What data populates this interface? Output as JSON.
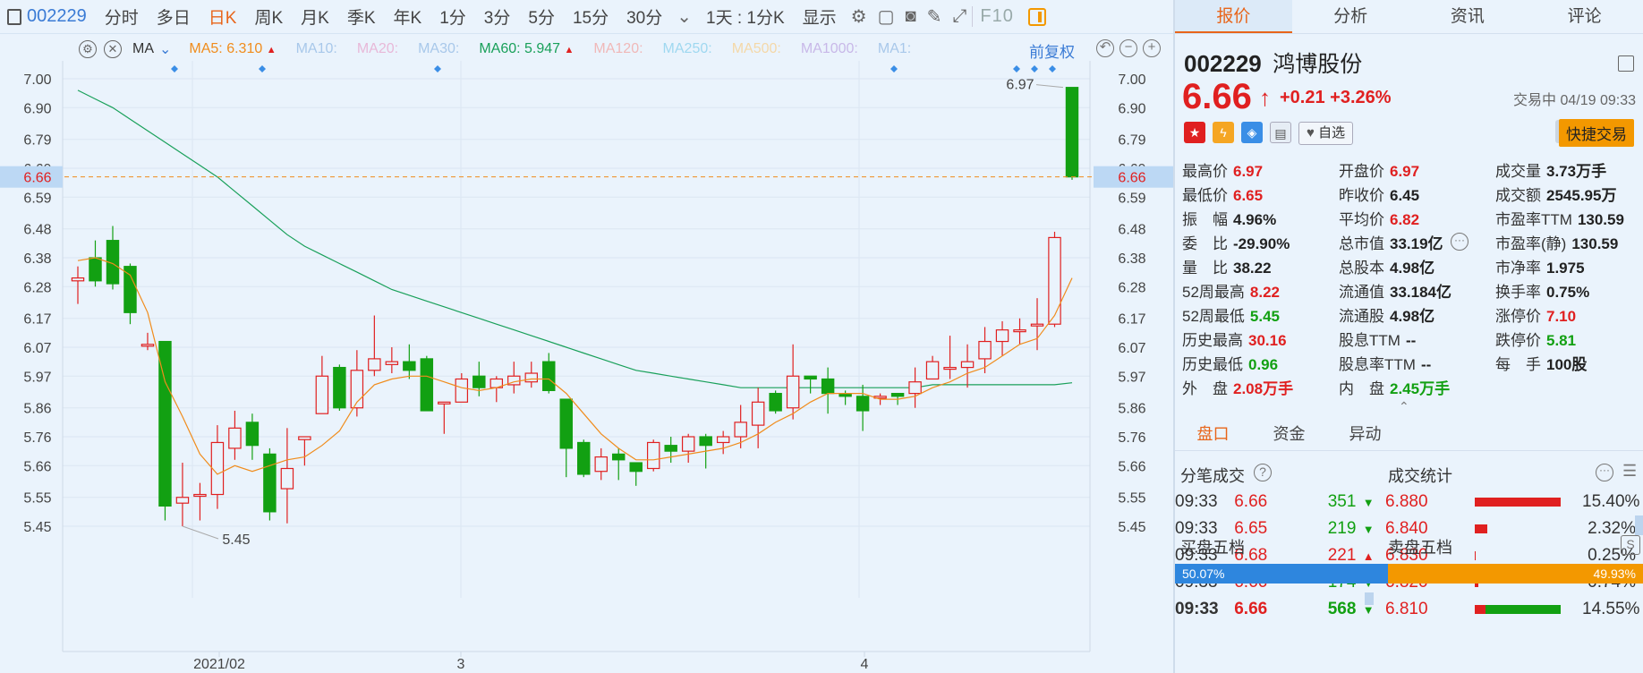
{
  "toolbar": {
    "code": "002229",
    "items": [
      "分时",
      "多日",
      "日K",
      "周K",
      "月K",
      "季K",
      "年K",
      "1分",
      "3分",
      "5分",
      "15分",
      "30分"
    ],
    "active_index": 2,
    "interval": "1天 : 1分K",
    "display": "显示",
    "f10": "F10"
  },
  "ma": {
    "label": "MA",
    "ma5": "MA5: 6.310",
    "ma10": "MA10:",
    "ma20": "MA20:",
    "ma30": "MA30:",
    "ma60": "MA60: 5.947",
    "ma120": "MA120:",
    "ma250": "MA250:",
    "ma500": "MA500:",
    "ma1000": "MA1000:",
    "ma1": "MA1:",
    "fq": "前复权",
    "colors": {
      "ma5": "#f08c1c",
      "ma60": "#19a05a",
      "faded": "#a8c8ea"
    }
  },
  "chart_data": {
    "type": "candlestick",
    "yticks": [
      "7.00",
      "6.90",
      "6.79",
      "6.69",
      "6.59",
      "6.48",
      "6.38",
      "6.28",
      "6.17",
      "6.07",
      "5.97",
      "5.86",
      "5.76",
      "5.66",
      "5.55",
      "5.45"
    ],
    "current_price_label": "6.66",
    "high_label": "6.97",
    "low_label": "5.45",
    "xlabels": [
      "2021/02",
      "3",
      "4"
    ],
    "candles": [
      [
        6.3,
        6.31,
        6.35,
        6.22
      ],
      [
        6.38,
        6.3,
        6.44,
        6.28
      ],
      [
        6.44,
        6.29,
        6.49,
        6.27
      ],
      [
        6.35,
        6.19,
        6.36,
        6.15
      ],
      [
        6.08,
        6.08,
        6.12,
        6.06
      ],
      [
        6.09,
        5.52,
        6.09,
        5.47
      ],
      [
        5.53,
        5.55,
        5.67,
        5.45
      ],
      [
        5.56,
        5.56,
        5.6,
        5.47
      ],
      [
        5.56,
        5.74,
        5.8,
        5.51
      ],
      [
        5.72,
        5.79,
        5.85,
        5.68
      ],
      [
        5.81,
        5.73,
        5.84,
        5.68
      ],
      [
        5.7,
        5.5,
        5.72,
        5.47
      ],
      [
        5.58,
        5.65,
        5.79,
        5.46
      ],
      [
        5.75,
        5.76,
        5.76,
        5.66
      ],
      [
        5.84,
        5.97,
        6.04,
        5.84
      ],
      [
        6.0,
        5.86,
        6.01,
        5.85
      ],
      [
        5.86,
        5.99,
        6.06,
        5.83
      ],
      [
        5.99,
        6.03,
        6.18,
        5.97
      ],
      [
        6.01,
        6.02,
        6.07,
        5.98
      ],
      [
        6.02,
        5.99,
        6.08,
        5.96
      ],
      [
        6.03,
        5.85,
        6.04,
        5.85
      ],
      [
        5.88,
        5.88,
        5.88,
        5.77
      ],
      [
        5.88,
        5.96,
        5.98,
        5.88
      ],
      [
        5.97,
        5.93,
        6.02,
        5.9
      ],
      [
        5.93,
        5.96,
        5.97,
        5.88
      ],
      [
        5.94,
        5.97,
        6.02,
        5.91
      ],
      [
        5.95,
        5.98,
        6.02,
        5.93
      ],
      [
        6.02,
        5.92,
        6.05,
        5.91
      ],
      [
        5.89,
        5.72,
        5.89,
        5.62
      ],
      [
        5.74,
        5.63,
        5.75,
        5.62
      ],
      [
        5.64,
        5.69,
        5.72,
        5.61
      ],
      [
        5.7,
        5.68,
        5.72,
        5.61
      ],
      [
        5.67,
        5.64,
        5.67,
        5.59
      ],
      [
        5.65,
        5.74,
        5.75,
        5.64
      ],
      [
        5.73,
        5.71,
        5.76,
        5.67
      ],
      [
        5.71,
        5.76,
        5.77,
        5.67
      ],
      [
        5.76,
        5.73,
        5.77,
        5.65
      ],
      [
        5.74,
        5.76,
        5.78,
        5.7
      ],
      [
        5.76,
        5.81,
        5.87,
        5.72
      ],
      [
        5.8,
        5.88,
        5.93,
        5.72
      ],
      [
        5.91,
        5.85,
        5.92,
        5.84
      ],
      [
        5.86,
        5.97,
        6.08,
        5.82
      ],
      [
        5.97,
        5.96,
        5.97,
        5.91
      ],
      [
        5.96,
        5.91,
        6.0,
        5.84
      ],
      [
        5.91,
        5.9,
        5.92,
        5.87
      ],
      [
        5.9,
        5.85,
        5.94,
        5.78
      ],
      [
        5.9,
        5.9,
        5.91,
        5.87
      ],
      [
        5.91,
        5.9,
        5.91,
        5.87
      ],
      [
        5.91,
        5.95,
        6.0,
        5.86
      ],
      [
        5.96,
        6.02,
        6.04,
        5.96
      ],
      [
        6.0,
        6.0,
        6.11,
        5.96
      ],
      [
        6.0,
        6.02,
        6.08,
        5.93
      ],
      [
        6.03,
        6.09,
        6.14,
        5.98
      ],
      [
        6.09,
        6.13,
        6.16,
        6.04
      ],
      [
        6.13,
        6.13,
        6.17,
        6.08
      ],
      [
        6.15,
        6.15,
        6.24,
        6.06
      ],
      [
        6.15,
        6.45,
        6.47,
        6.14
      ],
      [
        6.97,
        6.66,
        6.97,
        6.65
      ]
    ],
    "ma5": [
      6.37,
      6.38,
      6.36,
      6.32,
      6.19,
      5.95,
      5.83,
      5.7,
      5.63,
      5.66,
      5.64,
      5.66,
      5.68,
      5.69,
      5.73,
      5.78,
      5.88,
      5.94,
      5.96,
      5.97,
      5.97,
      5.95,
      5.93,
      5.92,
      5.93,
      5.95,
      5.96,
      5.96,
      5.91,
      5.84,
      5.77,
      5.72,
      5.68,
      5.68,
      5.69,
      5.7,
      5.71,
      5.72,
      5.74,
      5.77,
      5.81,
      5.84,
      5.88,
      5.91,
      5.91,
      5.91,
      5.89,
      5.89,
      5.9,
      5.93,
      5.95,
      5.98,
      6.0,
      6.04,
      6.08,
      6.1,
      6.18,
      6.31
    ],
    "ma60": [
      6.96,
      6.93,
      6.9,
      6.86,
      6.82,
      6.78,
      6.74,
      6.7,
      6.66,
      6.61,
      6.56,
      6.51,
      6.46,
      6.42,
      6.39,
      6.36,
      6.33,
      6.3,
      6.27,
      6.25,
      6.23,
      6.21,
      6.19,
      6.17,
      6.15,
      6.13,
      6.11,
      6.09,
      6.07,
      6.05,
      6.03,
      6.01,
      5.99,
      5.98,
      5.97,
      5.96,
      5.95,
      5.94,
      5.93,
      5.93,
      5.93,
      5.93,
      5.93,
      5.93,
      5.93,
      5.93,
      5.93,
      5.93,
      5.93,
      5.94,
      5.94,
      5.94,
      5.94,
      5.94,
      5.94,
      5.94,
      5.94,
      5.947
    ]
  },
  "quote": {
    "code": "002229",
    "name": "鸿博股份",
    "price": "6.66",
    "change": "+0.21",
    "pct": "+3.26%",
    "status": "交易中 04/19 09:33",
    "watch": "自选",
    "quick_trade": "快捷交易"
  },
  "tabs": [
    "报价",
    "分析",
    "资讯",
    "评论"
  ],
  "stats": [
    [
      {
        "l": "最高价",
        "v": "6.97",
        "c": "red"
      },
      {
        "l": "开盘价",
        "v": "6.97",
        "c": "red"
      },
      {
        "l": "成交量",
        "v": "3.73万手",
        "c": "dark"
      }
    ],
    [
      {
        "l": "最低价",
        "v": "6.65",
        "c": "red"
      },
      {
        "l": "昨收价",
        "v": "6.45",
        "c": "dark"
      },
      {
        "l": "成交额",
        "v": "2545.95万",
        "c": "dark"
      }
    ],
    [
      {
        "l": "振　幅",
        "v": "4.96%",
        "c": "dark"
      },
      {
        "l": "平均价",
        "v": "6.82",
        "c": "red"
      },
      {
        "l": "市盈率TTM",
        "v": "130.59",
        "c": "dark"
      }
    ],
    [
      {
        "l": "委　比",
        "v": "-29.90%",
        "c": "dark"
      },
      {
        "l": "总市值",
        "v": "33.19亿",
        "c": "dark"
      },
      {
        "l": "市盈率(静)",
        "v": "130.59",
        "c": "dark"
      }
    ],
    [
      {
        "l": "量　比",
        "v": "38.22",
        "c": "dark"
      },
      {
        "l": "总股本",
        "v": "4.98亿",
        "c": "dark"
      },
      {
        "l": "市净率",
        "v": "1.975",
        "c": "dark"
      }
    ],
    [
      {
        "l": "52周最高",
        "v": "8.22",
        "c": "red"
      },
      {
        "l": "流通值",
        "v": "33.184亿",
        "c": "dark"
      },
      {
        "l": "换手率",
        "v": "0.75%",
        "c": "dark"
      }
    ],
    [
      {
        "l": "52周最低",
        "v": "5.45",
        "c": "green"
      },
      {
        "l": "流通股",
        "v": "4.98亿",
        "c": "dark"
      },
      {
        "l": "涨停价",
        "v": "7.10",
        "c": "red"
      }
    ],
    [
      {
        "l": "历史最高",
        "v": "30.16",
        "c": "red"
      },
      {
        "l": "股息TTM",
        "v": "--",
        "c": "dark"
      },
      {
        "l": "跌停价",
        "v": "5.81",
        "c": "green"
      }
    ],
    [
      {
        "l": "历史最低",
        "v": "0.96",
        "c": "green"
      },
      {
        "l": "股息率TTM",
        "v": "--",
        "c": "dark"
      },
      {
        "l": "每　手",
        "v": "100股",
        "c": "dark"
      }
    ],
    [
      {
        "l": "外　盘",
        "v": "2.08万手",
        "c": "red"
      },
      {
        "l": "内　盘",
        "v": "2.45万手",
        "c": "green"
      }
    ]
  ],
  "subtabs": [
    "盘口",
    "资金",
    "异动"
  ],
  "trades_title": "分笔成交",
  "trades": [
    {
      "t": "09:33",
      "p": "6.66",
      "v": "351",
      "dir": "down"
    },
    {
      "t": "09:33",
      "p": "6.65",
      "v": "219",
      "dir": "down"
    },
    {
      "t": "09:33",
      "p": "6.68",
      "v": "221",
      "dir": "up"
    },
    {
      "t": "09:33",
      "p": "6.66",
      "v": "174",
      "dir": "down"
    },
    {
      "t": "09:33",
      "p": "6.66",
      "v": "568",
      "dir": "down"
    }
  ],
  "cj_title": "成交统计",
  "cj": [
    {
      "p": "6.880",
      "pct": "15.40%",
      "r": 0.8,
      "g": 0
    },
    {
      "p": "6.840",
      "pct": "2.32%",
      "r": 0.12,
      "g": 0
    },
    {
      "p": "6.830",
      "pct": "0.25%",
      "r": 0.01,
      "g": 0
    },
    {
      "p": "6.820",
      "pct": "0.74%",
      "r": 0.03,
      "g": 0
    },
    {
      "p": "6.810",
      "pct": "14.55%",
      "r": 0.1,
      "g": 0.7
    }
  ],
  "bid_title": "买盘五档",
  "ask_title": "卖盘五档",
  "bid_pct": "50.07%",
  "ask_pct": "49.93%"
}
